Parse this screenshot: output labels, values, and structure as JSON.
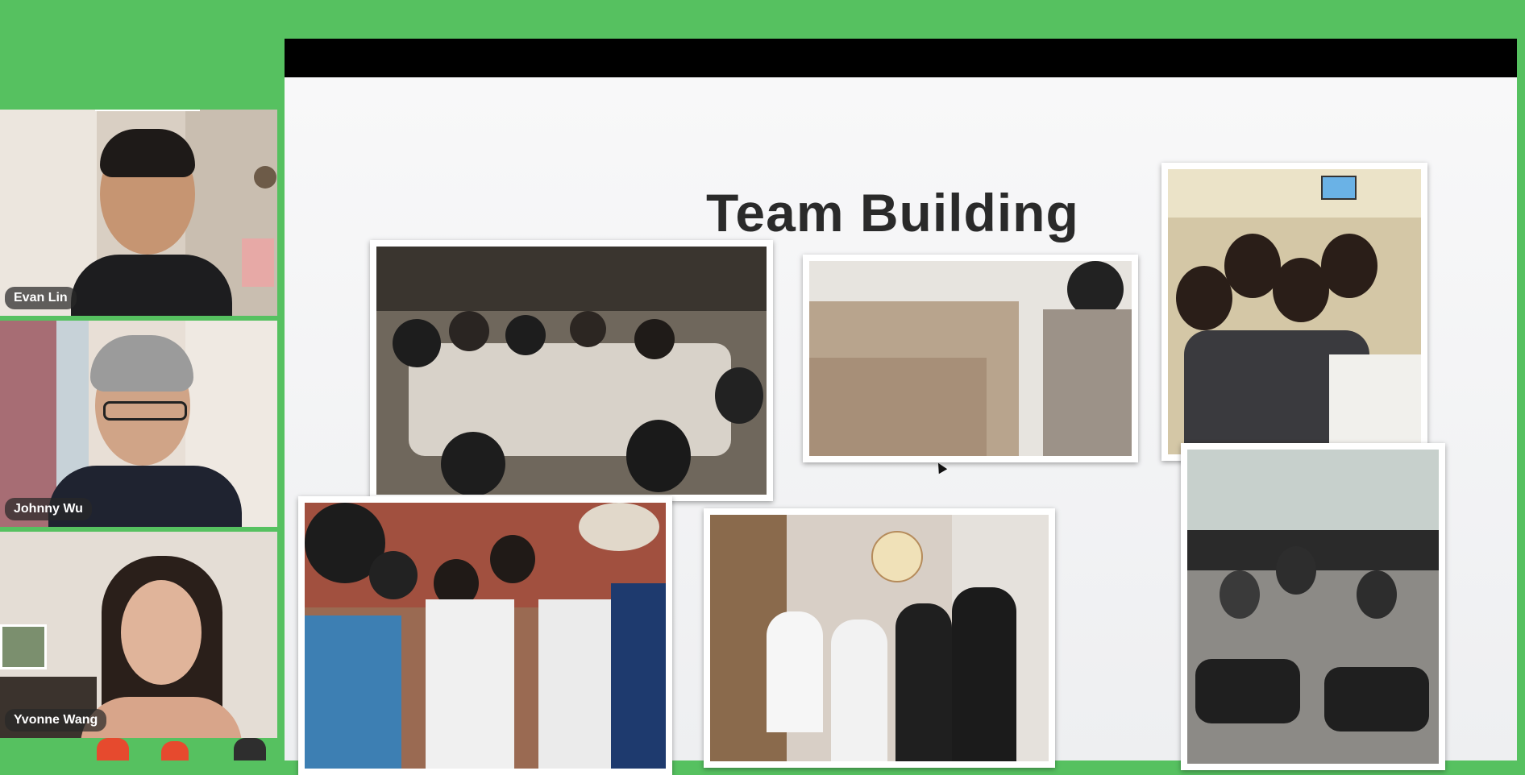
{
  "participants": [
    {
      "name": "Evan Lin"
    },
    {
      "name": "Johnny Wu"
    },
    {
      "name": "Yvonne Wang"
    }
  ],
  "slide": {
    "title": "Team Building"
  },
  "colors": {
    "background": "#56c160",
    "slide_bar": "#000000",
    "name_tag": "#282828"
  },
  "icons": [
    "mouse-cursor-icon"
  ]
}
